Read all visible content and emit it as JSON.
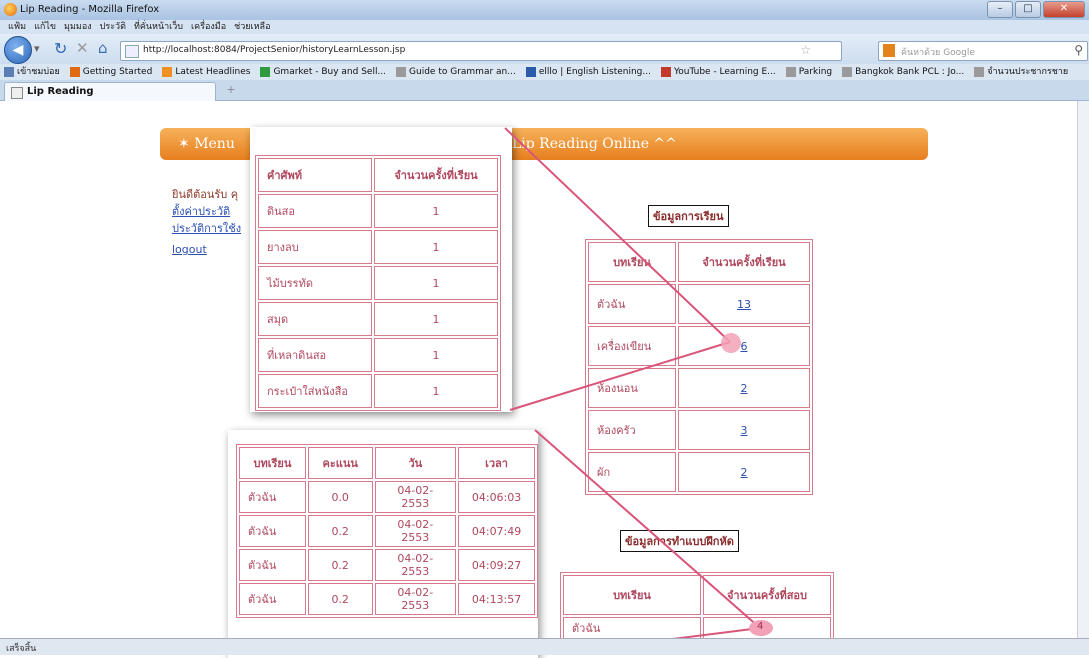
{
  "window": {
    "title": "Lip Reading - Mozilla Firefox",
    "min": "–",
    "max": "□",
    "close": "✕"
  },
  "menubar": [
    "แฟ้ม",
    "แก้ไข",
    "มุมมอง",
    "ประวัติ",
    "ที่คั่นหน้าเว็บ",
    "เครื่องมือ",
    "ช่วยเหลือ"
  ],
  "nav": {
    "url": "http://localhost:8084/ProjectSenior/historyLearnLesson.jsp",
    "search_placeholder": "ค้นหาด้วย Google"
  },
  "bookmarks": [
    {
      "label": "เข้าชมบ่อย",
      "icon": "page-icon",
      "color": "#5a7fb5"
    },
    {
      "label": "Getting Started",
      "icon": "firefox-icon",
      "color": "#e36a10"
    },
    {
      "label": "Latest Headlines",
      "icon": "rss-icon",
      "color": "#f09020"
    },
    {
      "label": "Gmarket - Buy and Sell...",
      "icon": "g-icon",
      "color": "#2c9c3e"
    },
    {
      "label": "Guide to Grammar an...",
      "icon": "page-icon",
      "color": "#999"
    },
    {
      "label": "elllo | English Listening...",
      "icon": "elllo-icon",
      "color": "#2a5aa8"
    },
    {
      "label": "YouTube - Learning E...",
      "icon": "youtube-icon",
      "color": "#c0392b"
    },
    {
      "label": "Parking",
      "icon": "page-icon",
      "color": "#999"
    },
    {
      "label": "Bangkok Bank PCL : Jo...",
      "icon": "page-icon",
      "color": "#999"
    },
    {
      "label": "จำนวนประชากรชาย",
      "icon": "page-icon",
      "color": "#999"
    }
  ],
  "tab": {
    "label": "Lip Reading",
    "new": "+"
  },
  "status": "เสร็จสิ้น",
  "banner": {
    "menu": "Menu",
    "title": "Lip Reading Online ^^",
    "star": "✶"
  },
  "sidebar": {
    "welcome": "ยินดีต้อนรับ คุ",
    "links": [
      "ตั้งค่าประวัติ",
      "ประวัติการใช้ง",
      "logout"
    ]
  },
  "lesson_section": {
    "caption": "ข้อมูลการเรียน",
    "headers": [
      "บทเรียน",
      "จำนวนครั้งที่เรียน"
    ],
    "rows": [
      [
        "ตัวฉัน",
        "13"
      ],
      [
        "เครื่องเขียน",
        "6"
      ],
      [
        "ห้องนอน",
        "2"
      ],
      [
        "ห้องครัว",
        "3"
      ],
      [
        "ผัก",
        "2"
      ]
    ]
  },
  "exercise_section": {
    "caption": "ข้อมูลการทำแบบฝึกหัด",
    "headers": [
      "บทเรียน",
      "จำนวนครั้งที่สอบ"
    ],
    "rows": [
      [
        "ตัวฉัน",
        "4"
      ]
    ]
  },
  "vocab_popup": {
    "headers": [
      "คำศัพท์",
      "จำนวนครั้งที่เรียน"
    ],
    "rows": [
      [
        "ดินสอ",
        "1"
      ],
      [
        "ยางลบ",
        "1"
      ],
      [
        "ไม้บรรทัด",
        "1"
      ],
      [
        "สมุด",
        "1"
      ],
      [
        "ที่เหลาดินสอ",
        "1"
      ],
      [
        "กระเป๋าใส่หนังสือ",
        "1"
      ]
    ]
  },
  "score_popup": {
    "headers": [
      "บทเรียน",
      "คะแนน",
      "วัน",
      "เวลา"
    ],
    "rows": [
      [
        "ตัวฉัน",
        "0.0",
        "04-02-2553",
        "04:06:03"
      ],
      [
        "ตัวฉัน",
        "0.2",
        "04-02-2553",
        "04:07:49"
      ],
      [
        "ตัวฉัน",
        "0.2",
        "04-02-2553",
        "04:09:27"
      ],
      [
        "ตัวฉัน",
        "0.2",
        "04-02-2553",
        "04:13:57"
      ]
    ]
  },
  "colors": {
    "accent": "#e67f1f",
    "table_border": "#d87a8c",
    "table_text": "#b0485e",
    "highlight": "#f2a1b6"
  }
}
